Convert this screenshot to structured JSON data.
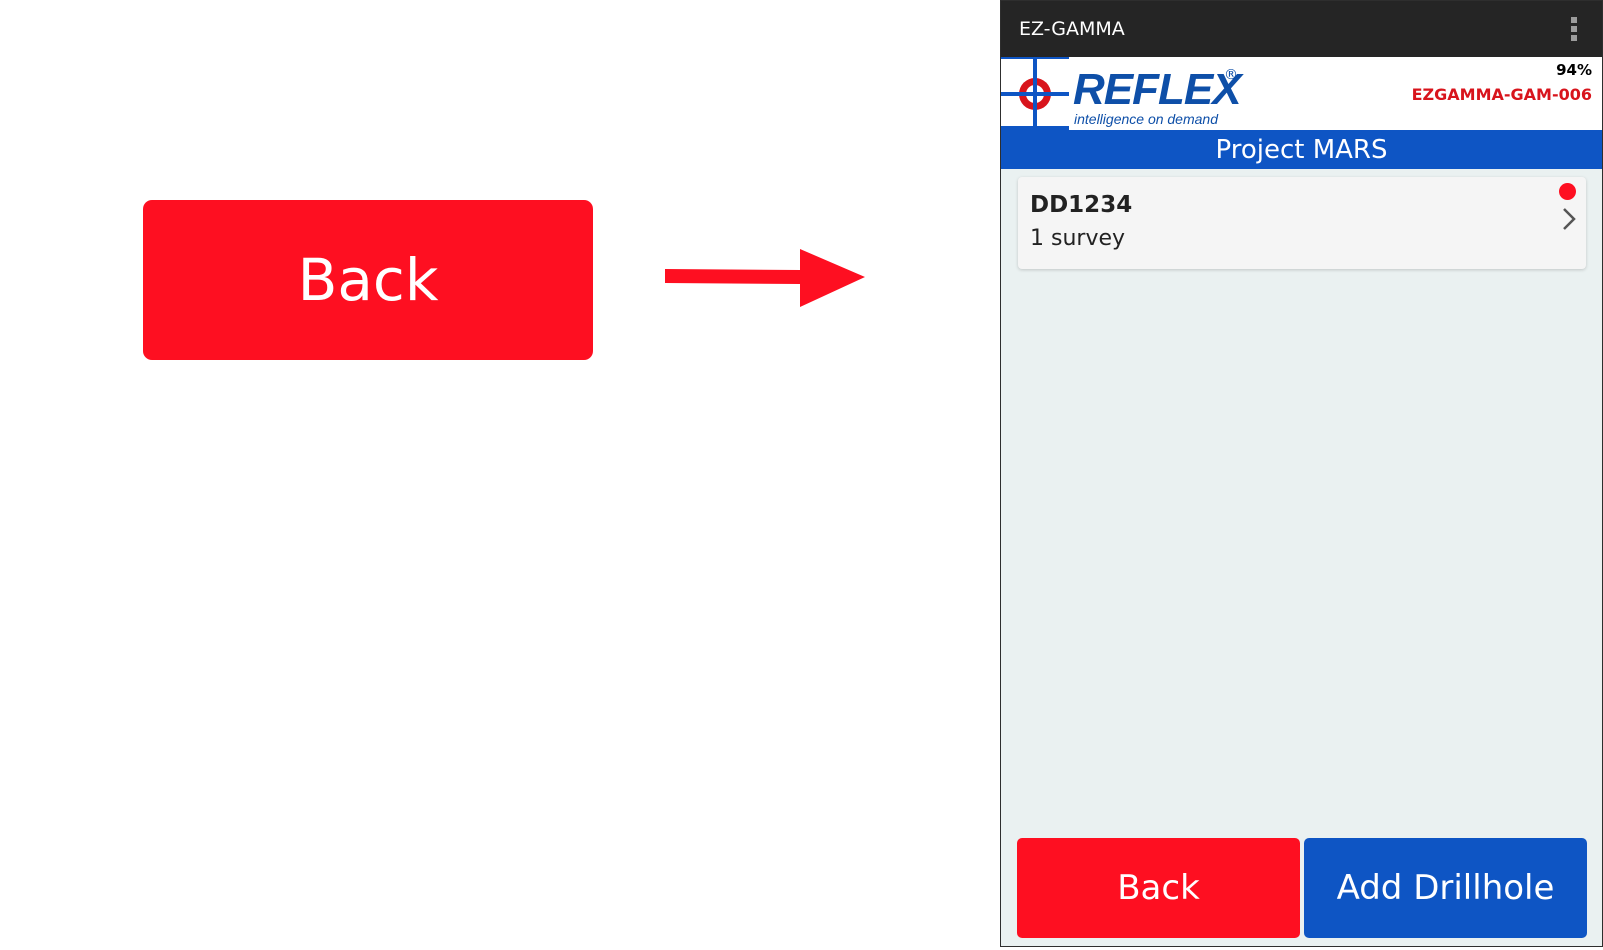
{
  "callout": {
    "back_label": "Back"
  },
  "app": {
    "title": "EZ-GAMMA",
    "brand": {
      "name": "REFLEX",
      "registered_mark": "®",
      "tagline": "intelligence on demand"
    },
    "battery_level": "94%",
    "device_id": "EZGAMMA-GAM-006",
    "project_title": "Project MARS"
  },
  "drillholes": [
    {
      "name": "DD1234",
      "subtitle": "1 survey",
      "status_color": "#fe0f21"
    }
  ],
  "buttons": {
    "back": "Back",
    "add_drillhole": "Add Drillhole"
  },
  "icons": [
    "arrow-right-icon",
    "overflow-menu-icon",
    "crosshair-logo-icon",
    "chevron-right-icon"
  ],
  "colors": {
    "back_red": "#fe0f21",
    "primary_blue": "#0e55c4",
    "brand_blue": "#0e4fa8",
    "device_id_red": "#d8141c",
    "action_bar": "#252525"
  }
}
